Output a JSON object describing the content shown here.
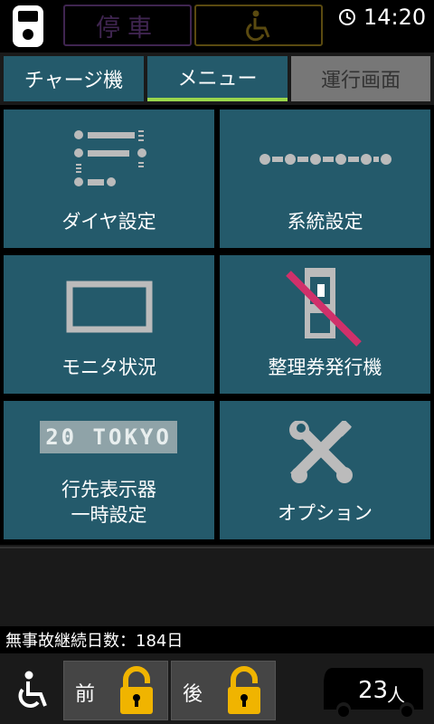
{
  "status": {
    "stop_label": "停車",
    "time": "14:20"
  },
  "tabs": [
    {
      "label": "チャージ機"
    },
    {
      "label": "メニュー"
    },
    {
      "label": "運行画面"
    }
  ],
  "menu": [
    {
      "label": "ダイヤ設定",
      "icon": "timetable-icon"
    },
    {
      "label": "系統設定",
      "icon": "route-line-icon"
    },
    {
      "label": "モニタ状況",
      "icon": "monitor-icon"
    },
    {
      "label": "整理券発行機",
      "icon": "ticket-machine-disabled-icon"
    },
    {
      "label": "行先表示器\n一時設定",
      "icon": "destination-display-icon",
      "display_text": "20 TOKYO"
    },
    {
      "label": "オプション",
      "icon": "tools-icon"
    }
  ],
  "info": {
    "accident_free": "無事故継続日数：184日"
  },
  "doors": [
    {
      "label": "前",
      "state": "locked"
    },
    {
      "label": "後",
      "state": "locked"
    }
  ],
  "passengers": {
    "count": "23",
    "unit": "人"
  },
  "colors": {
    "tile_bg": "#245a6b",
    "active_tab_underline": "#9ad64c",
    "lock_color": "#f0b400",
    "disabled_strike": "#d0306a"
  }
}
